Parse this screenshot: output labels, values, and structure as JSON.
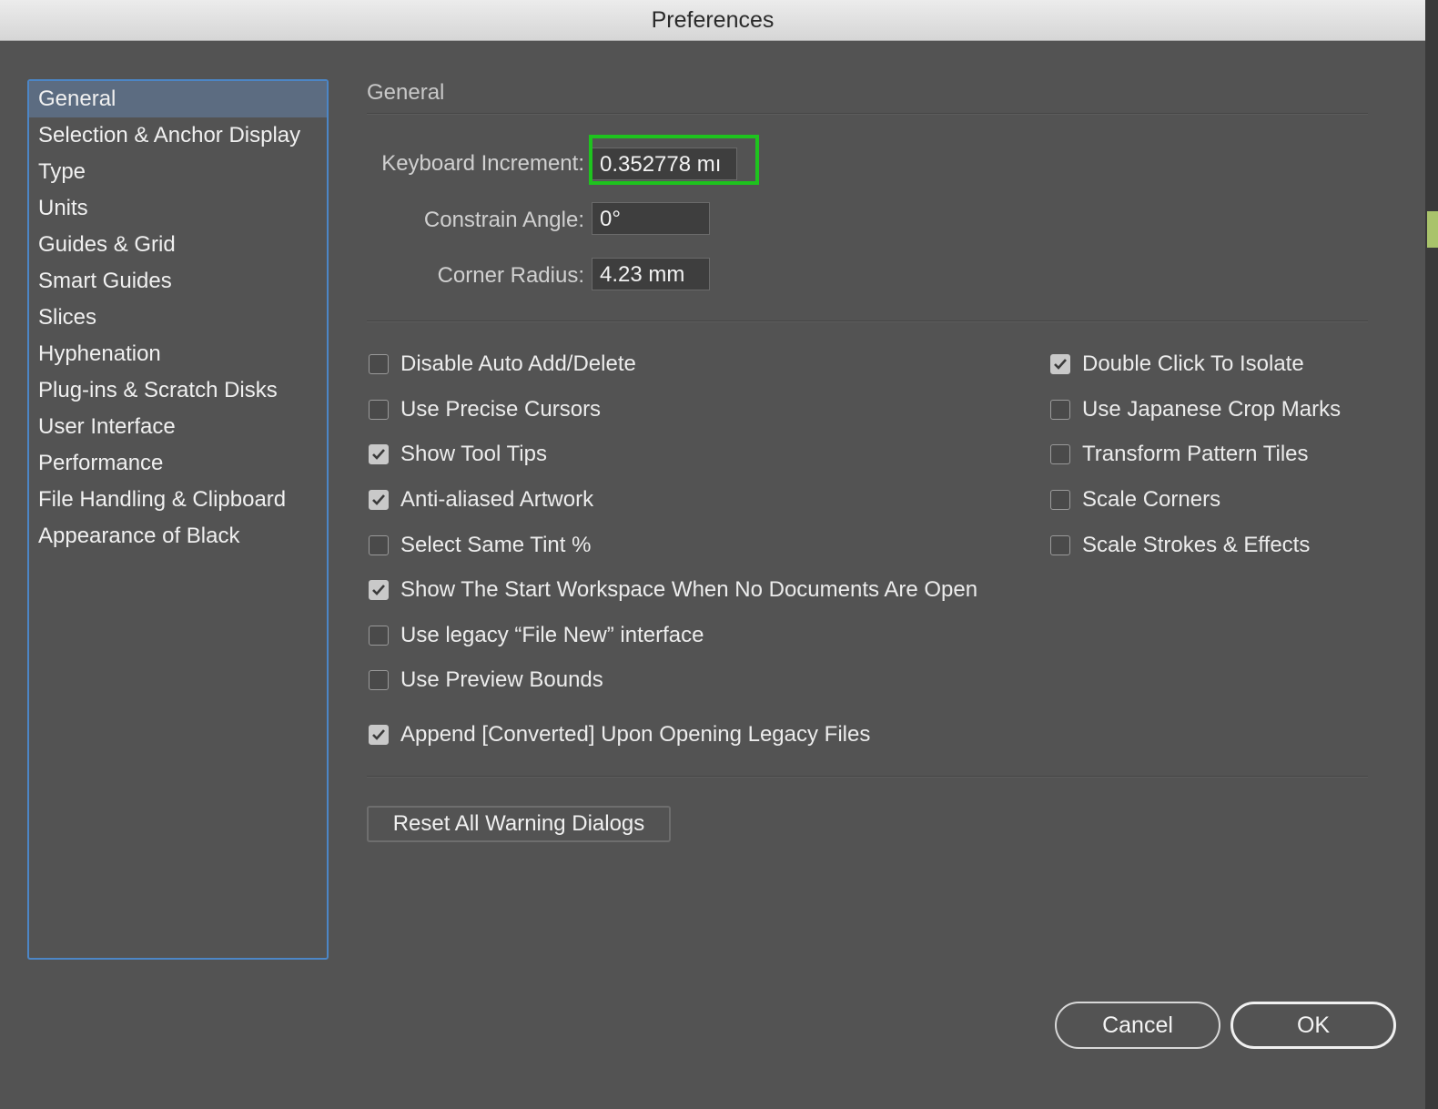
{
  "window": {
    "title": "Preferences"
  },
  "sidebar": {
    "items": [
      {
        "label": "General",
        "selected": true
      },
      {
        "label": "Selection & Anchor Display"
      },
      {
        "label": "Type"
      },
      {
        "label": "Units"
      },
      {
        "label": "Guides & Grid"
      },
      {
        "label": "Smart Guides"
      },
      {
        "label": "Slices"
      },
      {
        "label": "Hyphenation"
      },
      {
        "label": "Plug-ins & Scratch Disks"
      },
      {
        "label": "User Interface"
      },
      {
        "label": "Performance"
      },
      {
        "label": "File Handling & Clipboard"
      },
      {
        "label": "Appearance of Black"
      }
    ]
  },
  "main": {
    "section_title": "General",
    "fields": {
      "keyboard_increment": {
        "label": "Keyboard Increment:",
        "value": "0.352778 mı"
      },
      "constrain_angle": {
        "label": "Constrain Angle:",
        "value": "0°"
      },
      "corner_radius": {
        "label": "Corner Radius:",
        "value": "4.23 mm"
      }
    },
    "checkboxes_left": [
      {
        "label": "Disable Auto Add/Delete",
        "checked": false
      },
      {
        "label": "Use Precise Cursors",
        "checked": false
      },
      {
        "label": "Show Tool Tips",
        "checked": true
      },
      {
        "label": "Anti-aliased Artwork",
        "checked": true
      },
      {
        "label": "Select Same Tint %",
        "checked": false
      },
      {
        "label": "Show The Start Workspace When No Documents Are Open",
        "checked": true
      },
      {
        "label": "Use legacy “File New” interface",
        "checked": false
      },
      {
        "label": "Use Preview Bounds",
        "checked": false
      },
      {
        "label": "Append [Converted] Upon Opening Legacy Files",
        "checked": true
      }
    ],
    "checkboxes_right": [
      {
        "label": "Double Click To Isolate",
        "checked": true
      },
      {
        "label": "Use Japanese Crop Marks",
        "checked": false
      },
      {
        "label": "Transform Pattern Tiles",
        "checked": false
      },
      {
        "label": "Scale Corners",
        "checked": false
      },
      {
        "label": "Scale Strokes & Effects",
        "checked": false
      }
    ],
    "reset_button": "Reset All Warning Dialogs"
  },
  "footer": {
    "cancel_label": "Cancel",
    "ok_label": "OK"
  },
  "colors": {
    "selection": "#5c6c81",
    "focus_ring": "#4c86c6",
    "highlight_box": "#1ec31e",
    "background": "#535353"
  }
}
